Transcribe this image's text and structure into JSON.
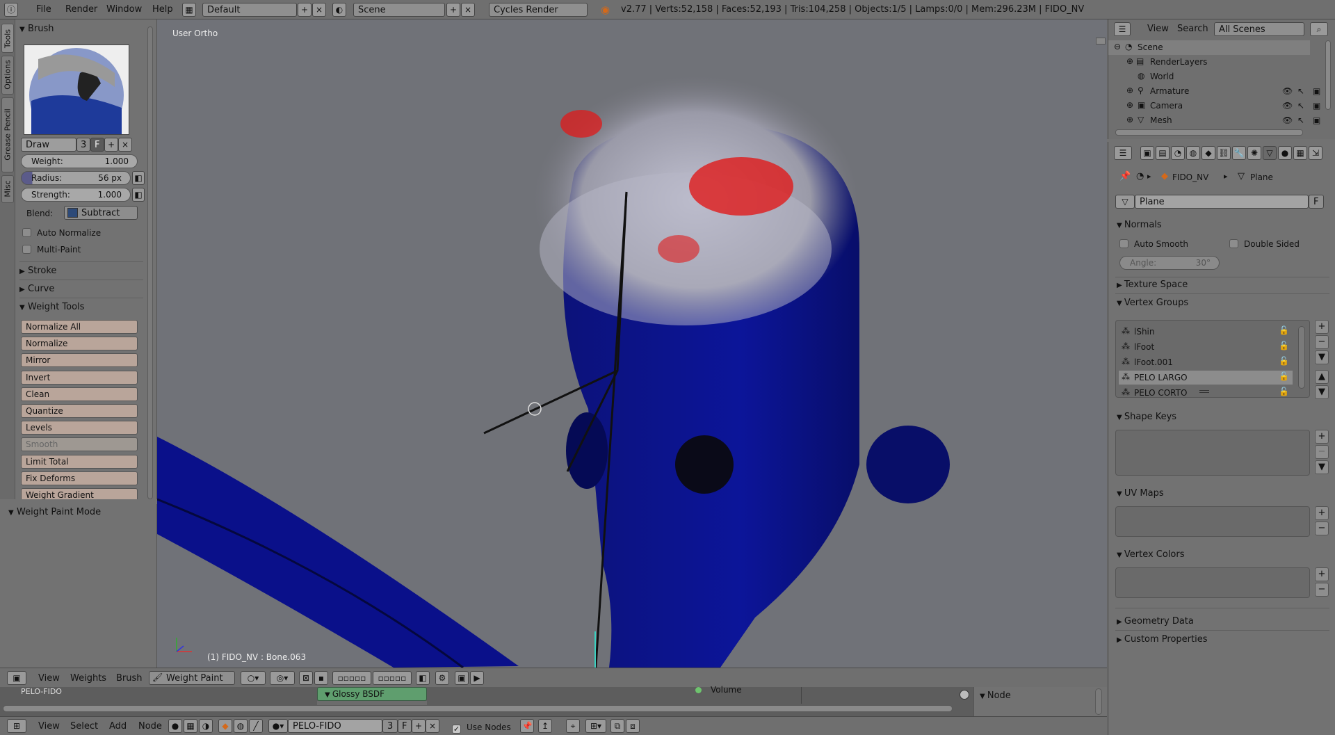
{
  "topbar": {
    "menus": [
      "File",
      "Render",
      "Window",
      "Help"
    ],
    "layout": "Default",
    "scene": "Scene",
    "engine": "Cycles Render",
    "stats": "v2.77 | Verts:52,158 | Faces:52,193 | Tris:104,258 | Objects:1/5 | Lamps:0/0 | Mem:296.23M | FIDO_NV"
  },
  "tooltabs": [
    "Tools",
    "Options",
    "Grease Pencil",
    "Misc"
  ],
  "toolshelf": {
    "brush_header": "Brush",
    "brush_name": "Draw",
    "brush_users": "3",
    "brush_fake": "F",
    "weight_label": "Weight:",
    "weight_value": "1.000",
    "radius_label": "Radius:",
    "radius_value": "56 px",
    "strength_label": "Strength:",
    "strength_value": "1.000",
    "blend_label": "Blend:",
    "blend_value": "Subtract",
    "auto_normalize": "Auto Normalize",
    "multi_paint": "Multi-Paint",
    "stroke": "Stroke",
    "curve": "Curve",
    "weight_tools": "Weight Tools",
    "tools": [
      {
        "label": "Normalize All",
        "enabled": true
      },
      {
        "label": "Normalize",
        "enabled": true
      },
      {
        "label": "Mirror",
        "enabled": true
      },
      {
        "label": "Invert",
        "enabled": true
      },
      {
        "label": "Clean",
        "enabled": true
      },
      {
        "label": "Quantize",
        "enabled": true
      },
      {
        "label": "Levels",
        "enabled": true
      },
      {
        "label": "Smooth",
        "enabled": false
      },
      {
        "label": "Limit Total",
        "enabled": true
      },
      {
        "label": "Fix Deforms",
        "enabled": true
      },
      {
        "label": "Weight Gradient",
        "enabled": true
      }
    ],
    "mode_panel": "Weight Paint Mode"
  },
  "viewport": {
    "view_name": "User Ortho",
    "object_info": "(1) FIDO_NV : Bone.063"
  },
  "outliner": {
    "menus": [
      "View",
      "Search"
    ],
    "scenes_select": "All Scenes",
    "rows": [
      "Scene",
      "RenderLayers",
      "World",
      "Armature",
      "Camera",
      "Mesh"
    ]
  },
  "properties": {
    "object": "FIDO_NV",
    "data": "Plane",
    "mesh_name": "Plane",
    "mesh_fake": "F",
    "normals": "Normals",
    "auto_smooth": "Auto Smooth",
    "double_sided": "Double Sided",
    "angle_label": "Angle:",
    "angle_value": "30°",
    "texture_space": "Texture Space",
    "vertex_groups": "Vertex Groups",
    "groups": [
      "lShin",
      "lFoot",
      "lFoot.001",
      "PELO LARGO",
      "PELO CORTO"
    ],
    "selected_group": "PELO LARGO",
    "shape_keys": "Shape Keys",
    "uv_maps": "UV Maps",
    "vertex_colors": "Vertex Colors",
    "geometry_data": "Geometry Data",
    "custom_properties": "Custom Properties"
  },
  "view3d_header": {
    "menus": [
      "View",
      "Weights",
      "Brush"
    ],
    "mode": "Weight Paint"
  },
  "node_editor": {
    "material_label": "PELO-FIDO",
    "node_name": "Glossy BSDF",
    "volume_label": "Volume",
    "panel_title": "Node",
    "menus": [
      "View",
      "Select",
      "Add",
      "Node"
    ],
    "material": "PELO-FIDO",
    "material_users": "3",
    "material_fake": "F",
    "use_nodes": "Use Nodes"
  },
  "colors": {
    "accent_selected": "#8c8c8c",
    "mesh_blue": "#0a1285",
    "weight_red": "#e01a1a",
    "node_green": "#5f9e6e"
  }
}
